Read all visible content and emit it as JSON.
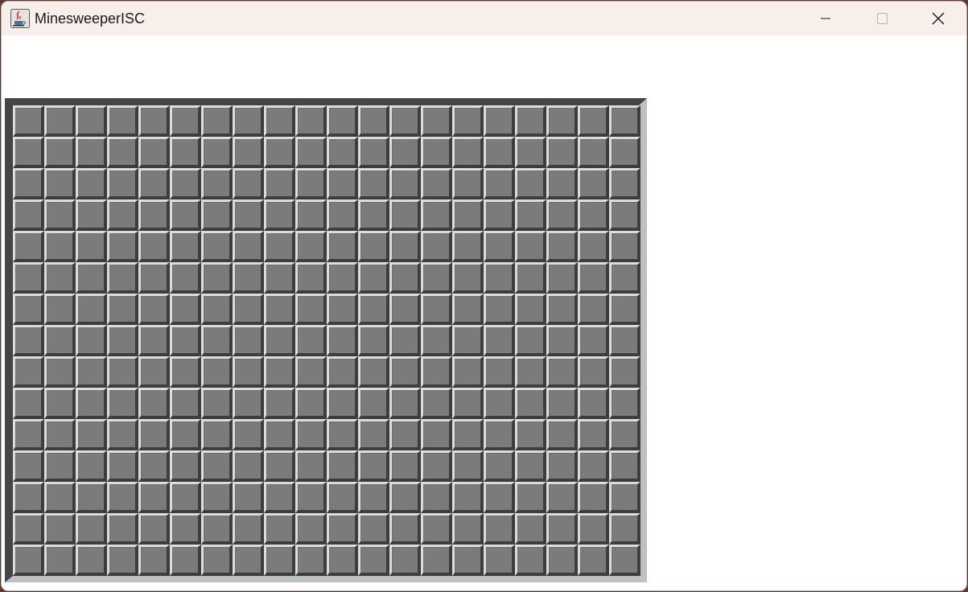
{
  "window": {
    "title": "MinesweeperISC",
    "icon": "java-cup-icon",
    "controls": {
      "minimize": "minimize-icon",
      "maximize": "maximize-icon",
      "close": "close-icon"
    }
  },
  "board": {
    "columns": 20,
    "rows": 15,
    "cell_state": "unrevealed",
    "colors": {
      "cell_face": "#7b7b7b",
      "cell_highlight": "#dddddd",
      "cell_shadow": "#3d3d3d",
      "board_background": "#c0c0c0",
      "board_frame": "#454545"
    }
  }
}
